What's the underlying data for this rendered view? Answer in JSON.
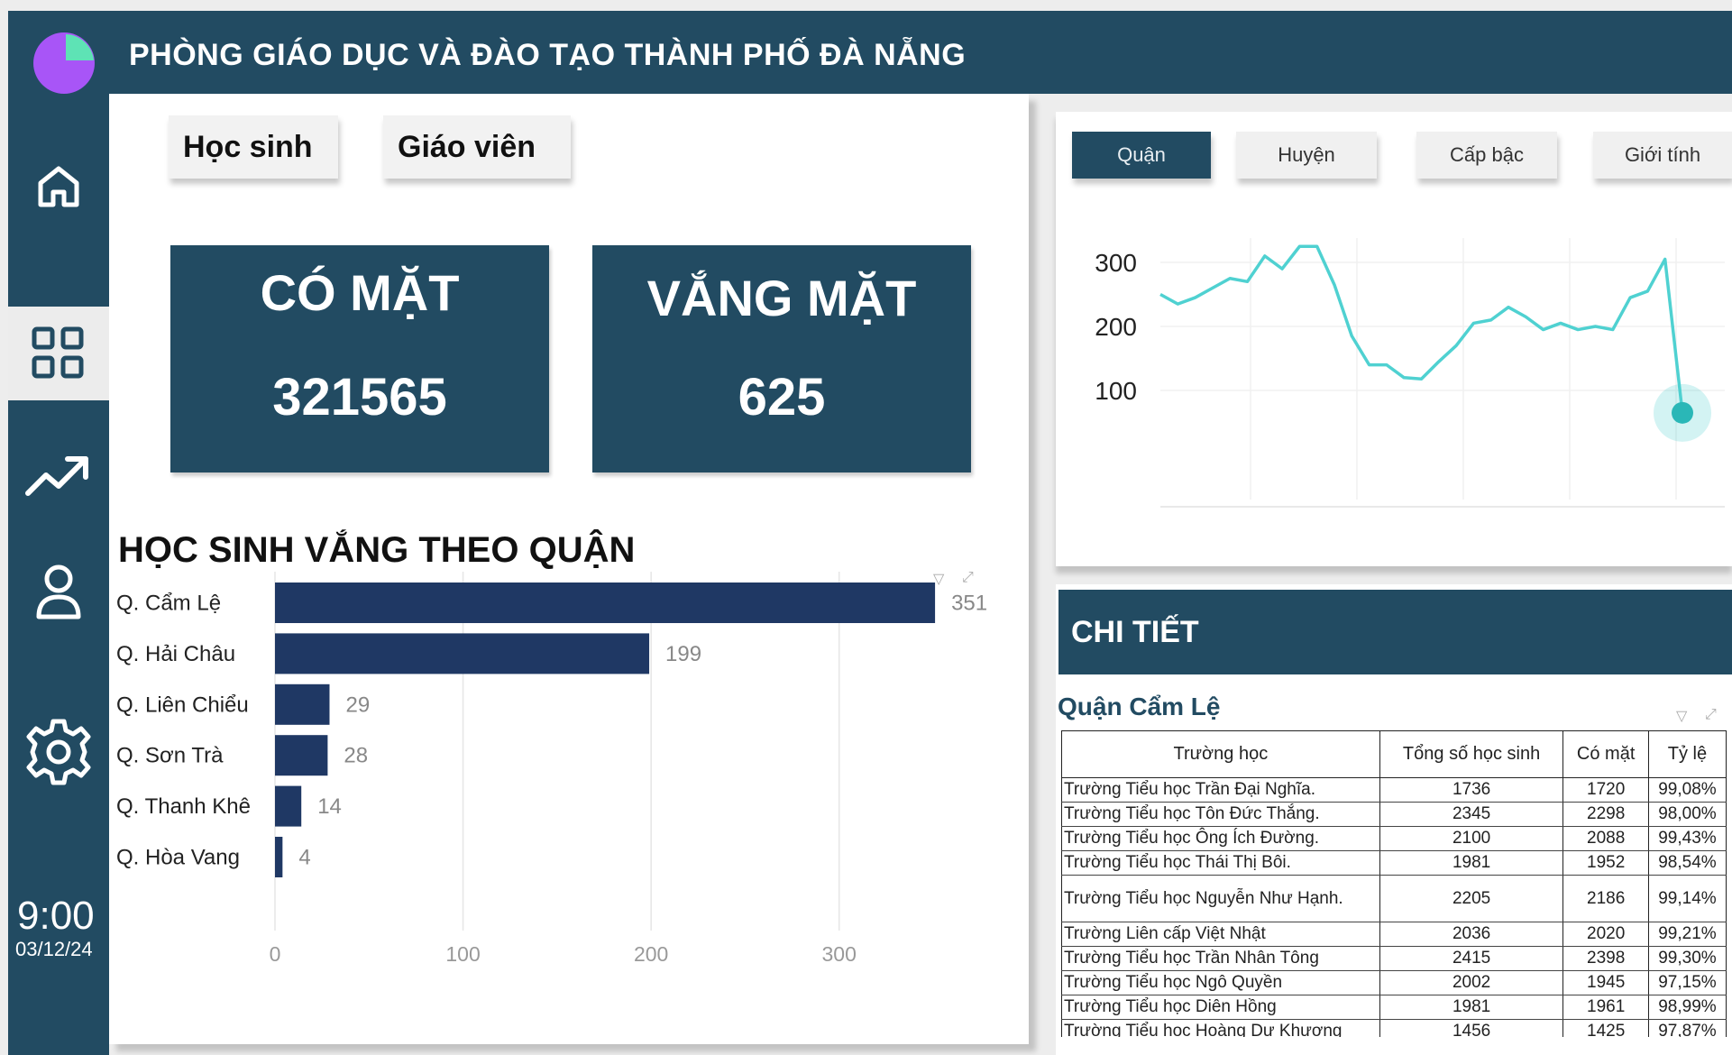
{
  "header": {
    "title": "PHÒNG GIÁO DỤC VÀ ĐÀO TẠO THÀNH PHỐ ĐÀ NẴNG"
  },
  "sidebar": {
    "items": [
      {
        "name": "home",
        "icon": "home-icon"
      },
      {
        "name": "dashboard",
        "icon": "grid-icon",
        "active": true
      },
      {
        "name": "trends",
        "icon": "trend-icon"
      },
      {
        "name": "profile",
        "icon": "user-icon"
      },
      {
        "name": "settings",
        "icon": "gear-icon"
      }
    ],
    "clock_time": "9:00",
    "clock_date": "03/12/24"
  },
  "toggles": {
    "students": "Học sinh",
    "teachers": "Giáo viên"
  },
  "kpis": {
    "present_label": "CÓ MẶT",
    "present_value": "321565",
    "absent_label": "VẮNG MẶT",
    "absent_value": "625"
  },
  "absence_section": {
    "title": "HỌC SINH VẮNG THEO QUẬN"
  },
  "filter_tabs": [
    "Quận",
    "Huyện",
    "Cấp bậc",
    "Giới tính"
  ],
  "detail": {
    "title": "CHI TIẾT",
    "subtitle": "Quận Cẩm Lệ",
    "columns": [
      "Trường học",
      "Tổng số học sinh",
      "Có mặt",
      "Tỷ lệ"
    ],
    "rows": [
      [
        "Trường Tiểu học Trần Đại Nghĩa.",
        "1736",
        "1720",
        "99,08%"
      ],
      [
        "Trường Tiểu học Tôn Đức Thắng.",
        "2345",
        "2298",
        "98,00%"
      ],
      [
        "Trường Tiểu học Ông Ích Đường.",
        "2100",
        "2088",
        "99,43%"
      ],
      [
        "Trường Tiểu học Thái Thị Bôi.",
        "1981",
        "1952",
        "98,54%"
      ],
      [
        "Trường Tiểu học Nguyễn Như Hạnh.",
        "2205",
        "2186",
        "99,14%"
      ],
      [
        "Trường Liên cấp Việt Nhật",
        "2036",
        "2020",
        "99,21%"
      ],
      [
        "Trường Tiểu học Trần Nhân Tông",
        "2415",
        "2398",
        "99,30%"
      ],
      [
        "Trường Tiểu học Ngô Quyền",
        "2002",
        "1945",
        "97,15%"
      ],
      [
        "Trường Tiểu học Diên Hồng",
        "1981",
        "1961",
        "98,99%"
      ],
      [
        "Trường Tiểu học Hoàng Dư Khương",
        "1456",
        "1425",
        "97,87%"
      ]
    ]
  },
  "colors": {
    "primary": "#224b62",
    "bar": "#1f3864",
    "line": "#4fd1d1",
    "logo_purple": "#a855f7",
    "logo_green": "#5ee3b5"
  },
  "chart_data": [
    {
      "type": "bar",
      "orientation": "horizontal",
      "categories": [
        "Q. Cẩm Lệ",
        "Q. Hải Châu",
        "Q. Liên Chiểu",
        "Q. Sơn Trà",
        "Q. Thanh Khê",
        "Q. Hòa Vang"
      ],
      "values": [
        351,
        199,
        29,
        28,
        14,
        4
      ],
      "xticks": [
        "0",
        "100",
        "200",
        "300"
      ],
      "xlim": [
        0,
        350
      ],
      "grid": true
    },
    {
      "type": "line",
      "y": [
        250,
        235,
        245,
        260,
        275,
        270,
        310,
        290,
        325,
        325,
        265,
        185,
        140,
        140,
        120,
        118,
        145,
        170,
        205,
        210,
        230,
        215,
        195,
        205,
        195,
        200,
        195,
        245,
        255,
        305,
        65
      ],
      "yticks": [
        "400",
        "300",
        "200",
        "100"
      ],
      "ylim": [
        0,
        410
      ],
      "grid": true
    }
  ]
}
